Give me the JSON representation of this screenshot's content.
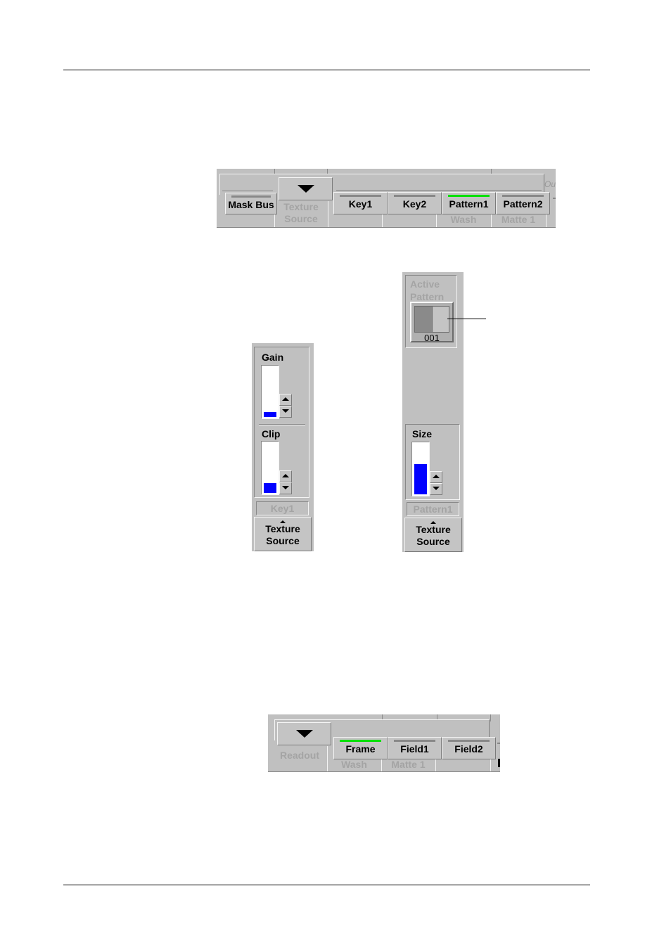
{
  "figure1": {
    "tabs": [
      {
        "label": "Mask Bus",
        "indicator": "off"
      },
      {
        "label": "Key1",
        "indicator": "off"
      },
      {
        "label": "Key2",
        "indicator": "off"
      },
      {
        "label": "Pattern1",
        "indicator": "on"
      },
      {
        "label": "Pattern2",
        "indicator": "off"
      }
    ],
    "dropdown_label_line1": "Texture",
    "dropdown_label_line2": "Source",
    "sublabels": [
      "Wash",
      "Matte 1"
    ],
    "edge_fragment": "Ou"
  },
  "key_panel": {
    "gain": {
      "label": "Gain",
      "level": 0.1
    },
    "clip": {
      "label": "Clip",
      "level": 0.2
    },
    "source_label": "Key1",
    "button_line1": "Texture",
    "button_line2": "Source"
  },
  "pattern_panel": {
    "active_pattern_line1": "Active",
    "active_pattern_line2": "Pattern",
    "pattern_number": "001",
    "size": {
      "label": "Size",
      "level": 0.6
    },
    "source_label": "Pattern1",
    "button_line1": "Texture",
    "button_line2": "Source"
  },
  "figure2": {
    "dropdown_label": "Readout",
    "tabs": [
      {
        "label": "Frame",
        "indicator": "on"
      },
      {
        "label": "Field1",
        "indicator": "off"
      },
      {
        "label": "Field2",
        "indicator": "off"
      }
    ],
    "sublabels": [
      "Wash",
      "Matte 1"
    ]
  },
  "colors": {
    "indicator_on": "#00e000",
    "indicator_off": "#888888",
    "meter_fill": "#0000ff",
    "panel_gray": "#c0c0c0"
  }
}
